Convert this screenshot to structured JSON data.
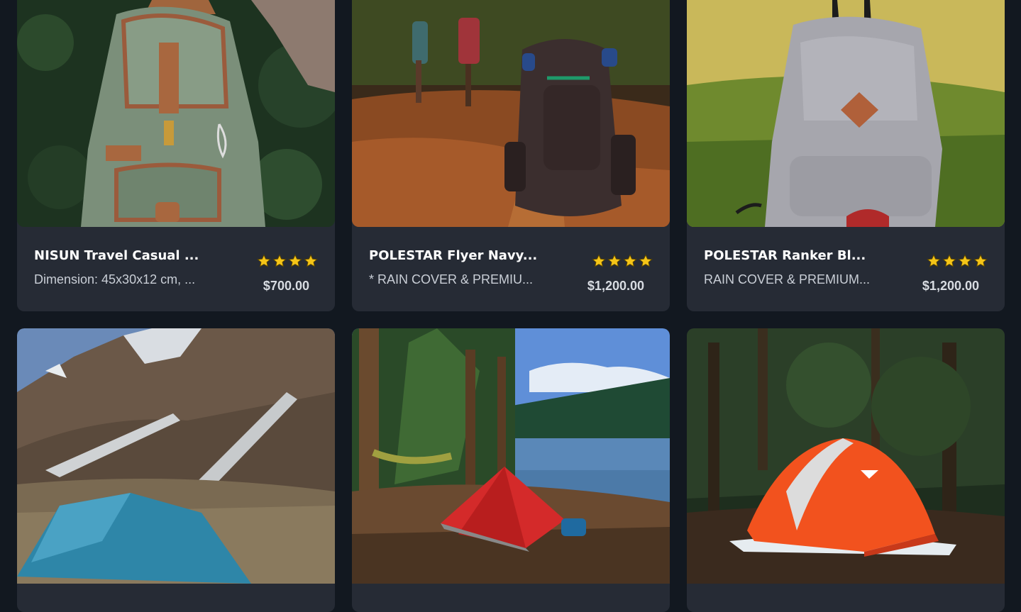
{
  "products": [
    {
      "title": "NISUN Travel Casual ...",
      "description": "Dimension: 45x30x12 cm, ...",
      "rating": 4,
      "price": "$700.00",
      "image": "green-canvas-backpack"
    },
    {
      "title": "POLESTAR Flyer Navy...",
      "description": "* RAIN COVER & PREMIU...",
      "rating": 4,
      "price": "$1,200.00",
      "image": "hiking-backpack-trail"
    },
    {
      "title": "POLESTAR Ranker Bl...",
      "description": "RAIN COVER & PREMIUM...",
      "rating": 4,
      "price": "$1,200.00",
      "image": "grey-backpack-grass"
    },
    {
      "image": "blue-tent-mountains"
    },
    {
      "image": "red-tent-lake"
    },
    {
      "image": "orange-tent-forest"
    }
  ],
  "colors": {
    "background": "#121820",
    "card": "#262b35",
    "title": "#ffffff",
    "description": "#c9ced6",
    "star": "#f5c518"
  }
}
